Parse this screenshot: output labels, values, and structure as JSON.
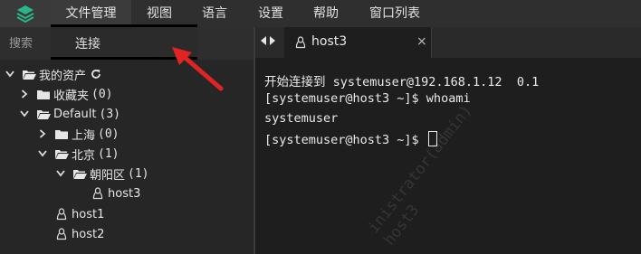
{
  "menubar": {
    "items": [
      "文件管理",
      "视图",
      "语言",
      "设置",
      "帮助",
      "窗口列表"
    ],
    "open_menu": {
      "items": [
        "连接"
      ]
    }
  },
  "sidebar": {
    "search_placeholder": "搜索",
    "search_ellipsis": "...",
    "tree": [
      {
        "label": "我的资产",
        "icon": "folder-open-icon"
      },
      {
        "label": "收藏夹",
        "count": "(0)",
        "icon": "folder-icon"
      },
      {
        "label": "Default",
        "count": "(3)",
        "icon": "folder-open-icon"
      },
      {
        "label": "上海",
        "count": "(0)",
        "icon": "folder-icon"
      },
      {
        "label": "北京",
        "count": "(1)",
        "icon": "folder-open-icon"
      },
      {
        "label": "朝阳区",
        "count": "(1)",
        "icon": "folder-open-icon"
      },
      {
        "label": "host3",
        "icon": "linux-icon"
      },
      {
        "label": "host1",
        "icon": "linux-icon"
      },
      {
        "label": "host2",
        "icon": "linux-icon"
      }
    ]
  },
  "tabs": [
    {
      "label": "host3",
      "active": true,
      "icon": "linux-icon"
    }
  ],
  "terminal": {
    "lines": [
      "开始连接到 systemuser@192.168.1.12  0.1",
      "[systemuser@host3 ~]$ whoami",
      "systemuser",
      "[systemuser@host3 ~]$ "
    ],
    "watermark": [
      "inistrator(admin)",
      "host3"
    ]
  },
  "colors": {
    "accent_logo": "#2bb58a",
    "annotation_arrow": "#e02424",
    "background": "#1e1e1e",
    "sidebar": "#262626"
  }
}
